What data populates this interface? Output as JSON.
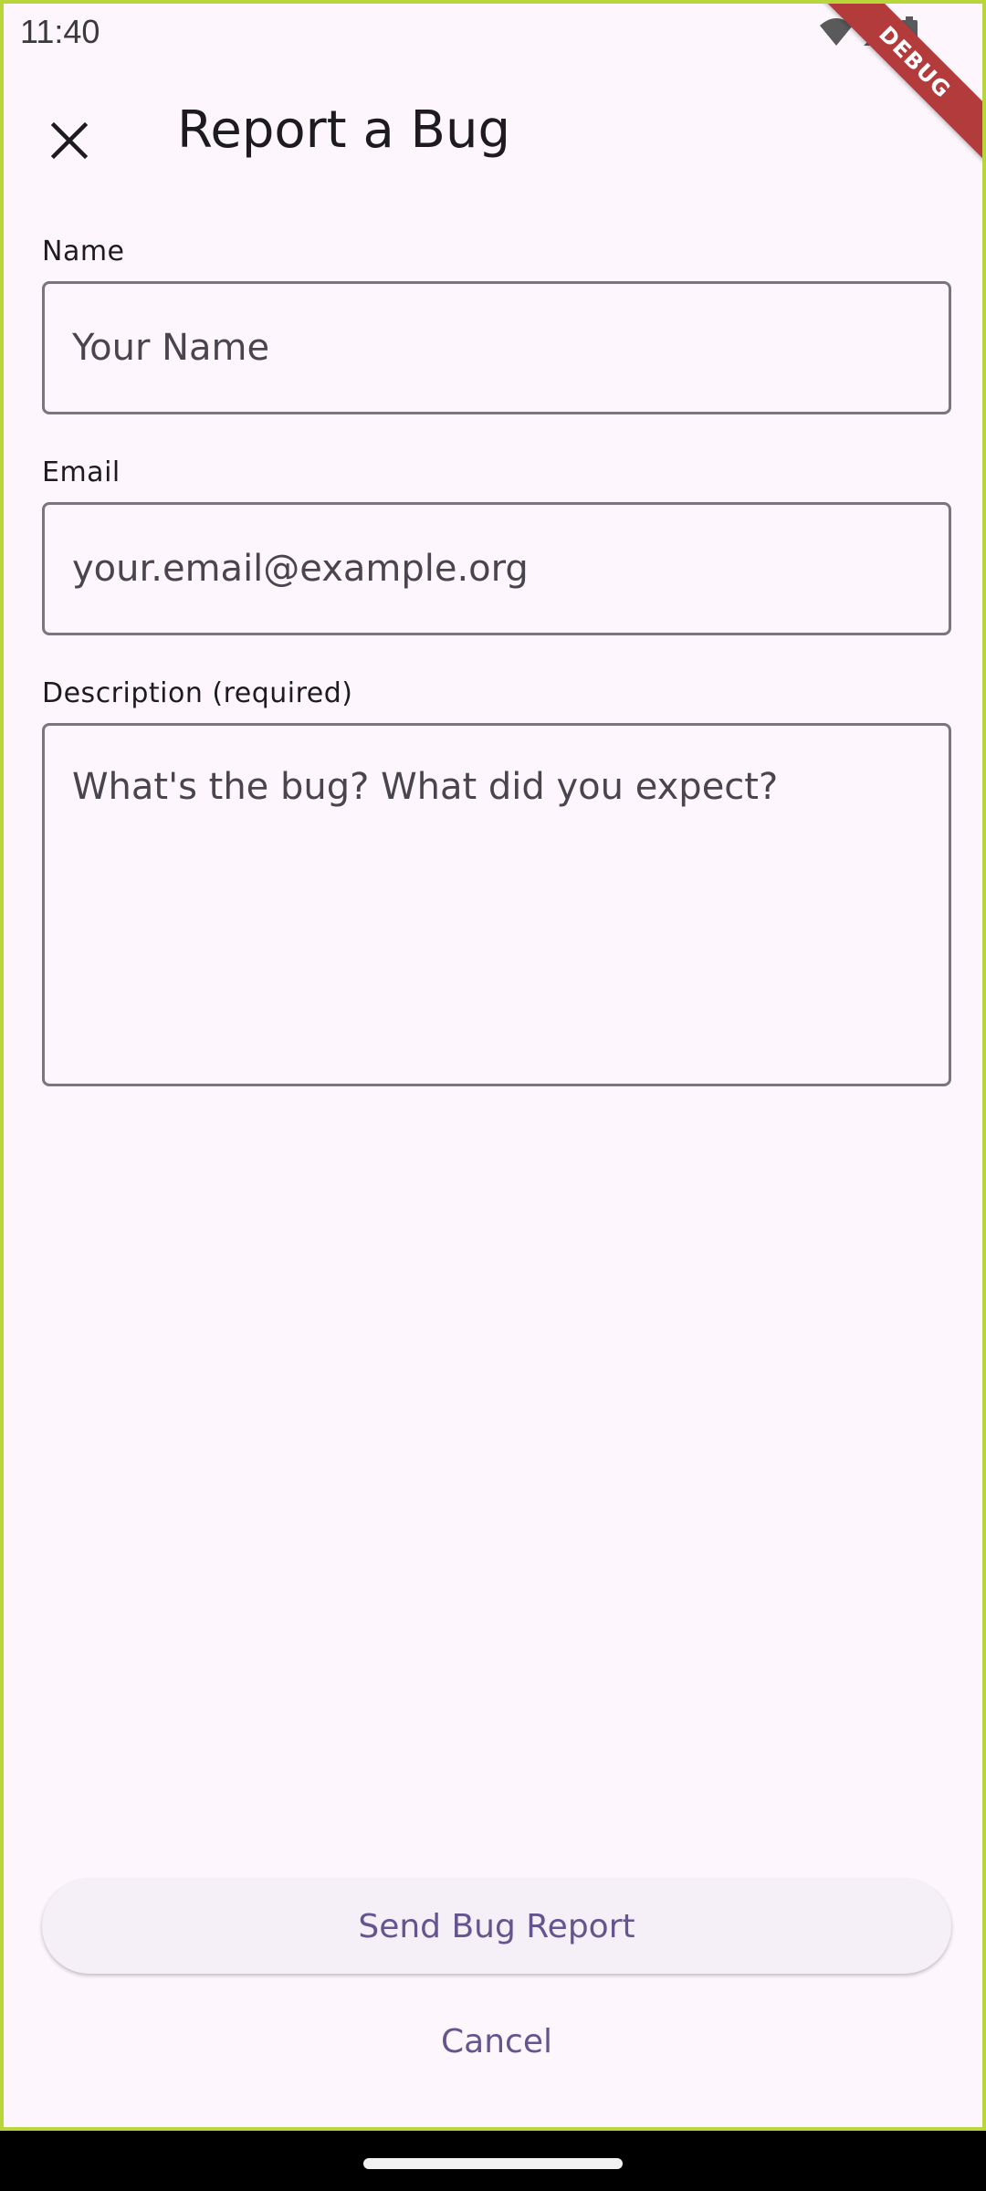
{
  "status_bar": {
    "time": "11:40"
  },
  "debug_banner": {
    "label": "DEBUG"
  },
  "app_bar": {
    "title": "Report a Bug",
    "close_icon": "close-icon"
  },
  "form": {
    "name": {
      "label": "Name",
      "placeholder": "Your Name",
      "value": ""
    },
    "email": {
      "label": "Email",
      "placeholder": "your.email@example.org",
      "value": ""
    },
    "description": {
      "label": "Description (required)",
      "placeholder": "What's the bug? What did you expect?",
      "value": ""
    }
  },
  "actions": {
    "send_label": "Send Bug Report",
    "cancel_label": "Cancel"
  },
  "colors": {
    "background": "#fdf7fd",
    "accent": "#65558f",
    "outline": "#7a757f",
    "debug": "#b33b3b"
  }
}
